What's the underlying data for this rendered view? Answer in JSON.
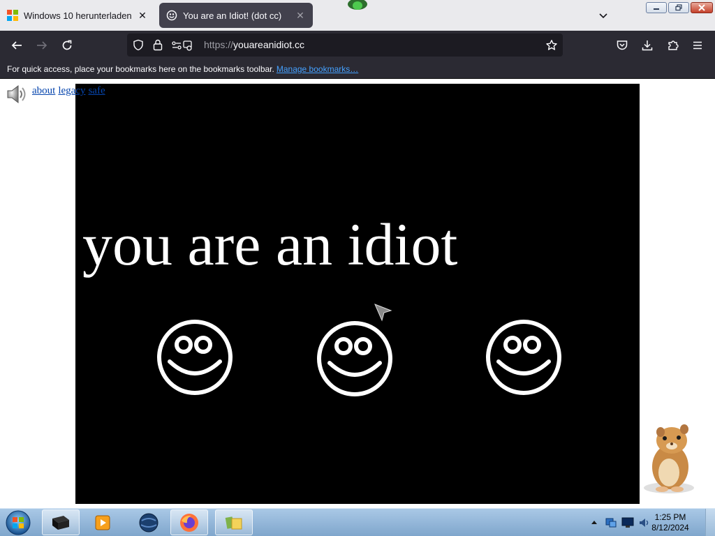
{
  "tabs": [
    {
      "title": "Windows 10 herunterladen",
      "icon": "windows-logo-icon"
    },
    {
      "title": "You are an Idiot! (dot cc)",
      "icon": "smiley-icon"
    }
  ],
  "navbar": {
    "url_protocol": "https://",
    "url_host": "youareanidiot.cc"
  },
  "bookmarks_bar": {
    "message": "For quick access, place your bookmarks here on the bookmarks toolbar.",
    "manage_link": "Manage bookmarks…"
  },
  "page": {
    "links": [
      "about",
      "legacy",
      "safe"
    ],
    "headline": "you are an idiot"
  },
  "taskbar": {
    "time": "1:25 PM",
    "date": "8/12/2024"
  },
  "colors": {
    "tab_bar": "#eaeaed",
    "toolbar": "#2b2a33",
    "urlbar": "#1c1b22",
    "stage": "#000000",
    "link": "#45a1ff"
  }
}
